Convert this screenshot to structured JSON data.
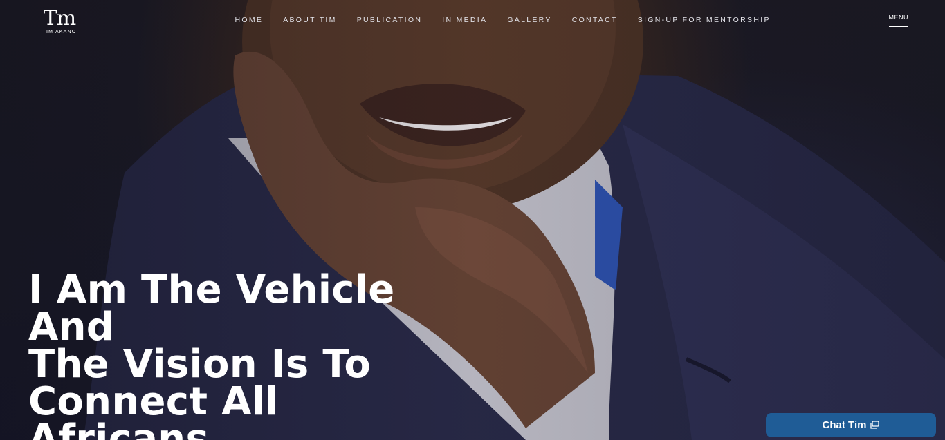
{
  "logo": {
    "mark": "Tm",
    "text": "TIM AKANO"
  },
  "nav": {
    "items": [
      {
        "label": "HOME"
      },
      {
        "label": "ABOUT TIM"
      },
      {
        "label": "PUBLICATION"
      },
      {
        "label": "IN MEDIA"
      },
      {
        "label": "GALLERY"
      },
      {
        "label": "CONTACT"
      },
      {
        "label": "SIGN-UP FOR MENTORSHIP"
      }
    ],
    "menu_label": "MENU"
  },
  "hero": {
    "headline_line1": "I Am The Vehicle And",
    "headline_line2": "The Vision Is To",
    "headline_line3": "Connect All Africans"
  },
  "chat": {
    "label": "Chat Tim",
    "icon": "chat-window-icon",
    "color": "#1f5c96"
  },
  "colors": {
    "background": "#1c1c2a",
    "text": "#ffffff",
    "accent": "#1f5c96"
  }
}
